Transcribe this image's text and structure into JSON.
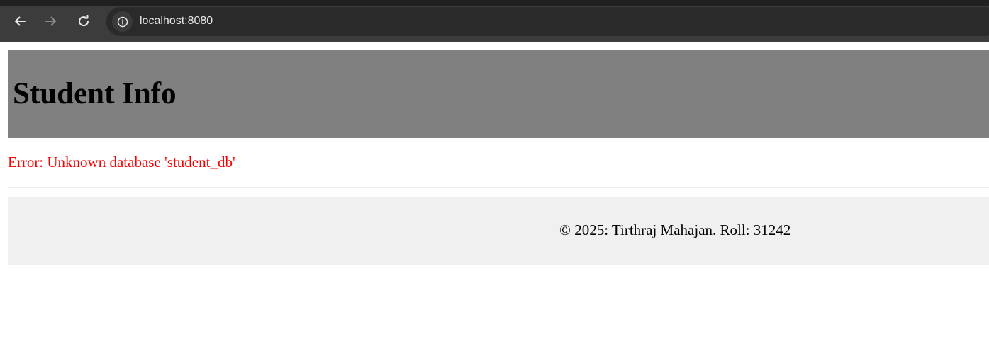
{
  "browser": {
    "url": "localhost:8080",
    "back_icon": "arrow-left-icon",
    "forward_icon": "arrow-right-icon",
    "reload_icon": "reload-icon",
    "info_icon": "info-icon"
  },
  "header": {
    "title": "Student Info",
    "background_color": "#808080"
  },
  "error": {
    "message": "Error: Unknown database 'student_db'",
    "color": "#ff0000"
  },
  "footer": {
    "text": "© 2025: Tirthraj Mahajan. Roll: 31242",
    "background_color": "#f0f0f0"
  }
}
